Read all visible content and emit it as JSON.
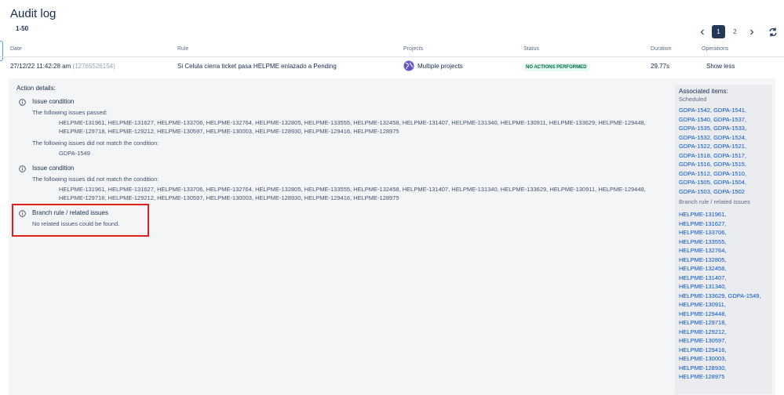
{
  "header": {
    "title": "Audit log",
    "range": "1-50"
  },
  "pagination": {
    "pages": [
      "1",
      "2"
    ],
    "active": "1"
  },
  "table": {
    "columns": [
      "Date",
      "Rule",
      "Projects",
      "Status",
      "Duration",
      "Operations"
    ],
    "row": {
      "date": "27/12/22 11:42:28 am",
      "id": "(12765526154)",
      "rule": "Si Celula cierra ticket pasa HELPME enlazado a Pending",
      "projects": "Multiple projects",
      "status": "NO ACTIONS PERFORMED",
      "duration": "29.77s",
      "operation": "Show less"
    }
  },
  "details": {
    "title": "Action details:",
    "cond1": {
      "title": "Issue condition",
      "passed_label": "The following issues passed:",
      "passed_issues": "HELPME-131961, HELPME-131627, HELPME-133706, HELPME-132764, HELPME-132805, HELPME-133555, HELPME-132458, HELPME-131407, HELPME-131340, HELPME-130911, HELPME-133629, HELPME-129448,",
      "passed_issues_2": "HELPME-129718, HELPME-129212, HELPME-130597, HELPME-130003, HELPME-128930, HELPME-129416, HELPME-128975",
      "failed_label": "The following issues did not match the condition:",
      "failed_issues": "GDPA-1549"
    },
    "cond2": {
      "title": "Issue condition",
      "failed_label": "The following issues did not match the condition:",
      "failed_issues": "HELPME-131961, HELPME-131627, HELPME-133706, HELPME-132764, HELPME-132805, HELPME-133555, HELPME-132458, HELPME-131407, HELPME-131340, HELPME-133629, HELPME-130911, HELPME-129448,",
      "failed_issues_2": "HELPME-129718, HELPME-129212, HELPME-130597, HELPME-130003, HELPME-128930, HELPME-129416, HELPME-128975"
    },
    "branch": {
      "title": "Branch rule / related issues",
      "text": "No related issues could be found."
    }
  },
  "associated": {
    "title": "Associated items:",
    "scheduled": "Scheduled",
    "scheduled_links": [
      "GDPA-1542,",
      "GDPA-1541,",
      "GDPA-1540,",
      "GDPA-1537,",
      "GDPA-1535,",
      "GDPA-1533,",
      "GDPA-1532,",
      "GDPA-1524,",
      "GDPA-1522,",
      "GDPA-1521,",
      "GDPA-1518,",
      "GDPA-1517,",
      "GDPA-1516,",
      "GDPA-1515,",
      "GDPA-1512,",
      "GDPA-1510,",
      "GDPA-1505,",
      "GDPA-1504,",
      "GDPA-1503,",
      "GDPA-1502"
    ],
    "branch": "Branch rule / related issues",
    "branch_links": [
      "HELPME-131961,",
      "HELPME-131627,",
      "HELPME-133706,",
      "HELPME-133555,",
      "HELPME-132764,",
      "HELPME-132805,",
      "HELPME-132458,",
      "HELPME-131407,",
      "HELPME-131340,",
      "HELPME-133629,",
      "GDPA-1549,",
      "HELPME-130911,",
      "HELPME-129448,",
      "HELPME-129718,",
      "HELPME-129212,",
      "HELPME-130597,",
      "HELPME-129416,",
      "HELPME-130003,",
      "HELPME-128930,",
      "HELPME-128975"
    ]
  },
  "colors": {
    "link": "#0052cc",
    "highlight": "#e01e1e",
    "badge_bg": "#e3fcef",
    "badge_fg": "#006644"
  }
}
